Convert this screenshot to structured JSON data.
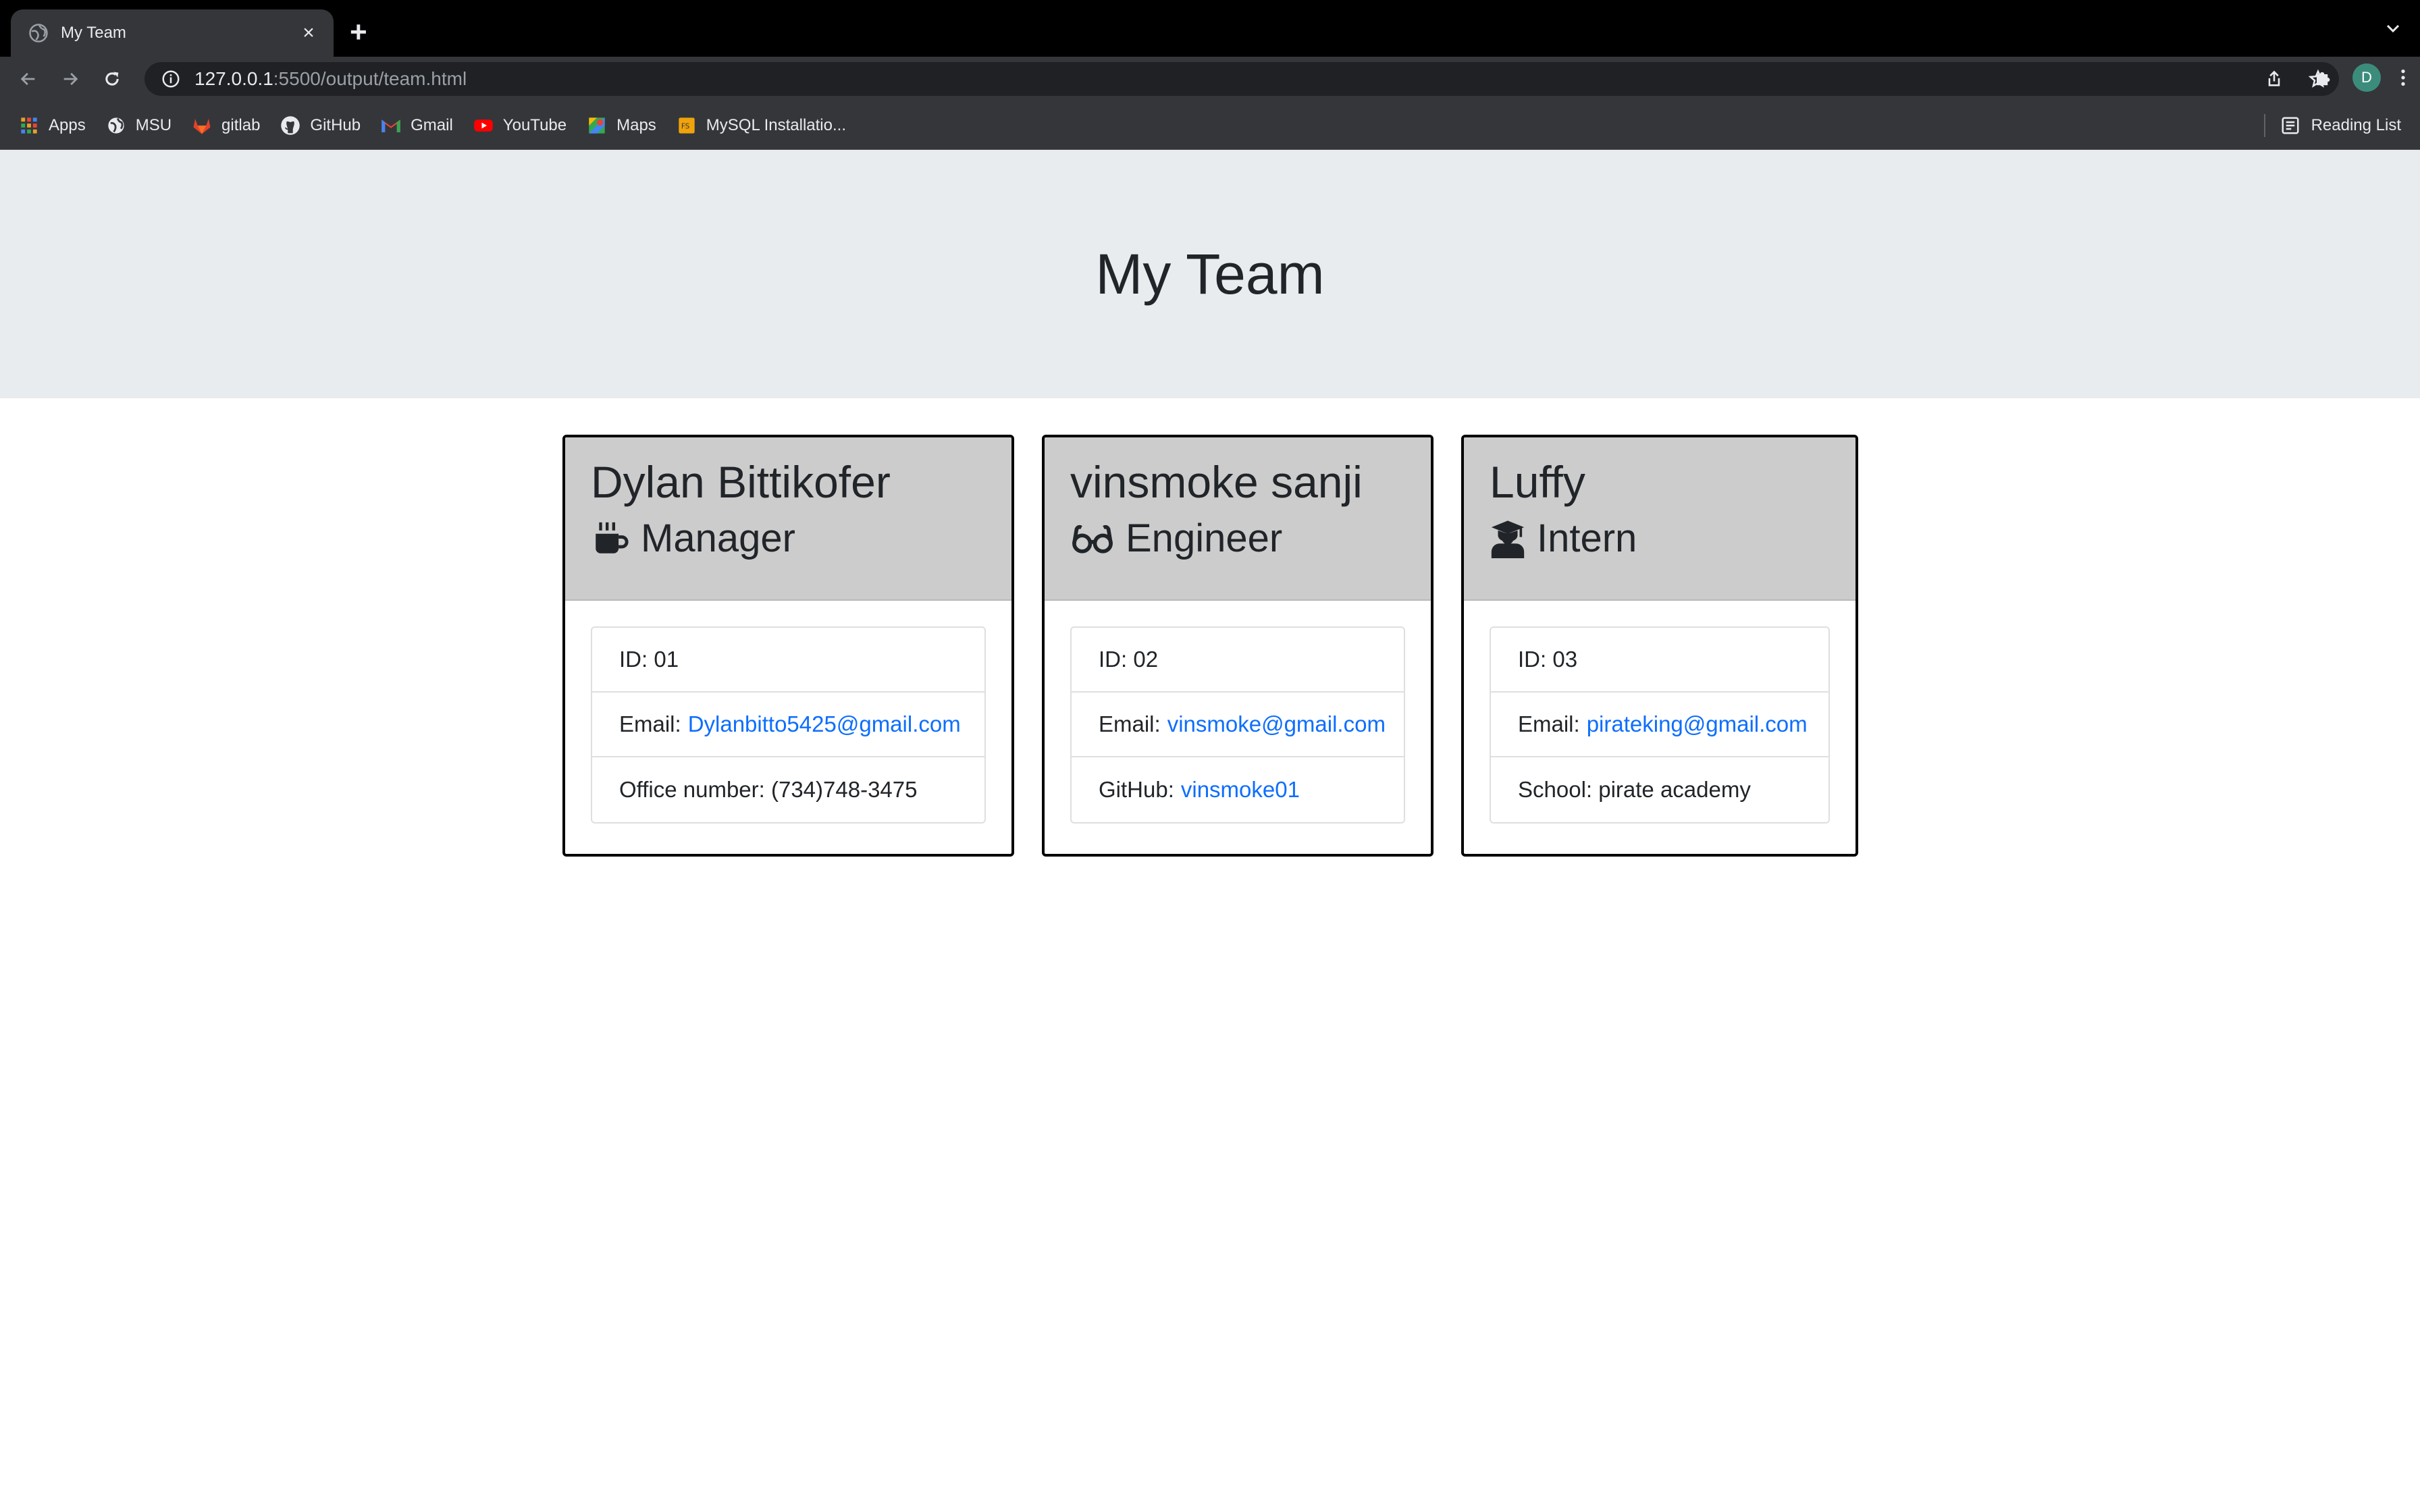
{
  "browser": {
    "tab_title": "My Team",
    "url_host": "127.0.0.1",
    "url_rest": ":5500/output/team.html",
    "profile_initial": "D",
    "bookmarks": [
      {
        "label": "Apps",
        "icon": "apps-grid-icon"
      },
      {
        "label": "MSU",
        "icon": "globe-icon"
      },
      {
        "label": "gitlab",
        "icon": "gitlab-icon"
      },
      {
        "label": "GitHub",
        "icon": "github-icon"
      },
      {
        "label": "Gmail",
        "icon": "gmail-icon"
      },
      {
        "label": "YouTube",
        "icon": "youtube-icon"
      },
      {
        "label": "Maps",
        "icon": "maps-icon"
      },
      {
        "label": "MySQL Installatio...",
        "icon": "mysql-icon"
      }
    ],
    "reading_list": "Reading List"
  },
  "page": {
    "title": "My Team"
  },
  "team": [
    {
      "name": "Dylan Bittikofer",
      "role": "Manager",
      "role_icon": "mug-icon",
      "id_label": "ID: 01",
      "email_label": "Email:",
      "email": "Dylanbitto5425@gmail.com",
      "extra_label": "Office number: (734)748-3475",
      "extra_link": ""
    },
    {
      "name": "vinsmoke sanji",
      "role": "Engineer",
      "role_icon": "glasses-icon",
      "id_label": "ID: 02",
      "email_label": "Email:",
      "email": "vinsmoke@gmail.com",
      "extra_label": "GitHub:",
      "extra_link": "vinsmoke01"
    },
    {
      "name": "Luffy",
      "role": "Intern",
      "role_icon": "graduate-icon",
      "id_label": "ID: 03",
      "email_label": "Email:",
      "email": "pirateking@gmail.com",
      "extra_label": "School: pirate academy",
      "extra_link": ""
    }
  ],
  "colors": {
    "link": "#0d6efd",
    "jumbotron_bg": "#e9ecef",
    "card_header_bg": "#cccccc"
  }
}
